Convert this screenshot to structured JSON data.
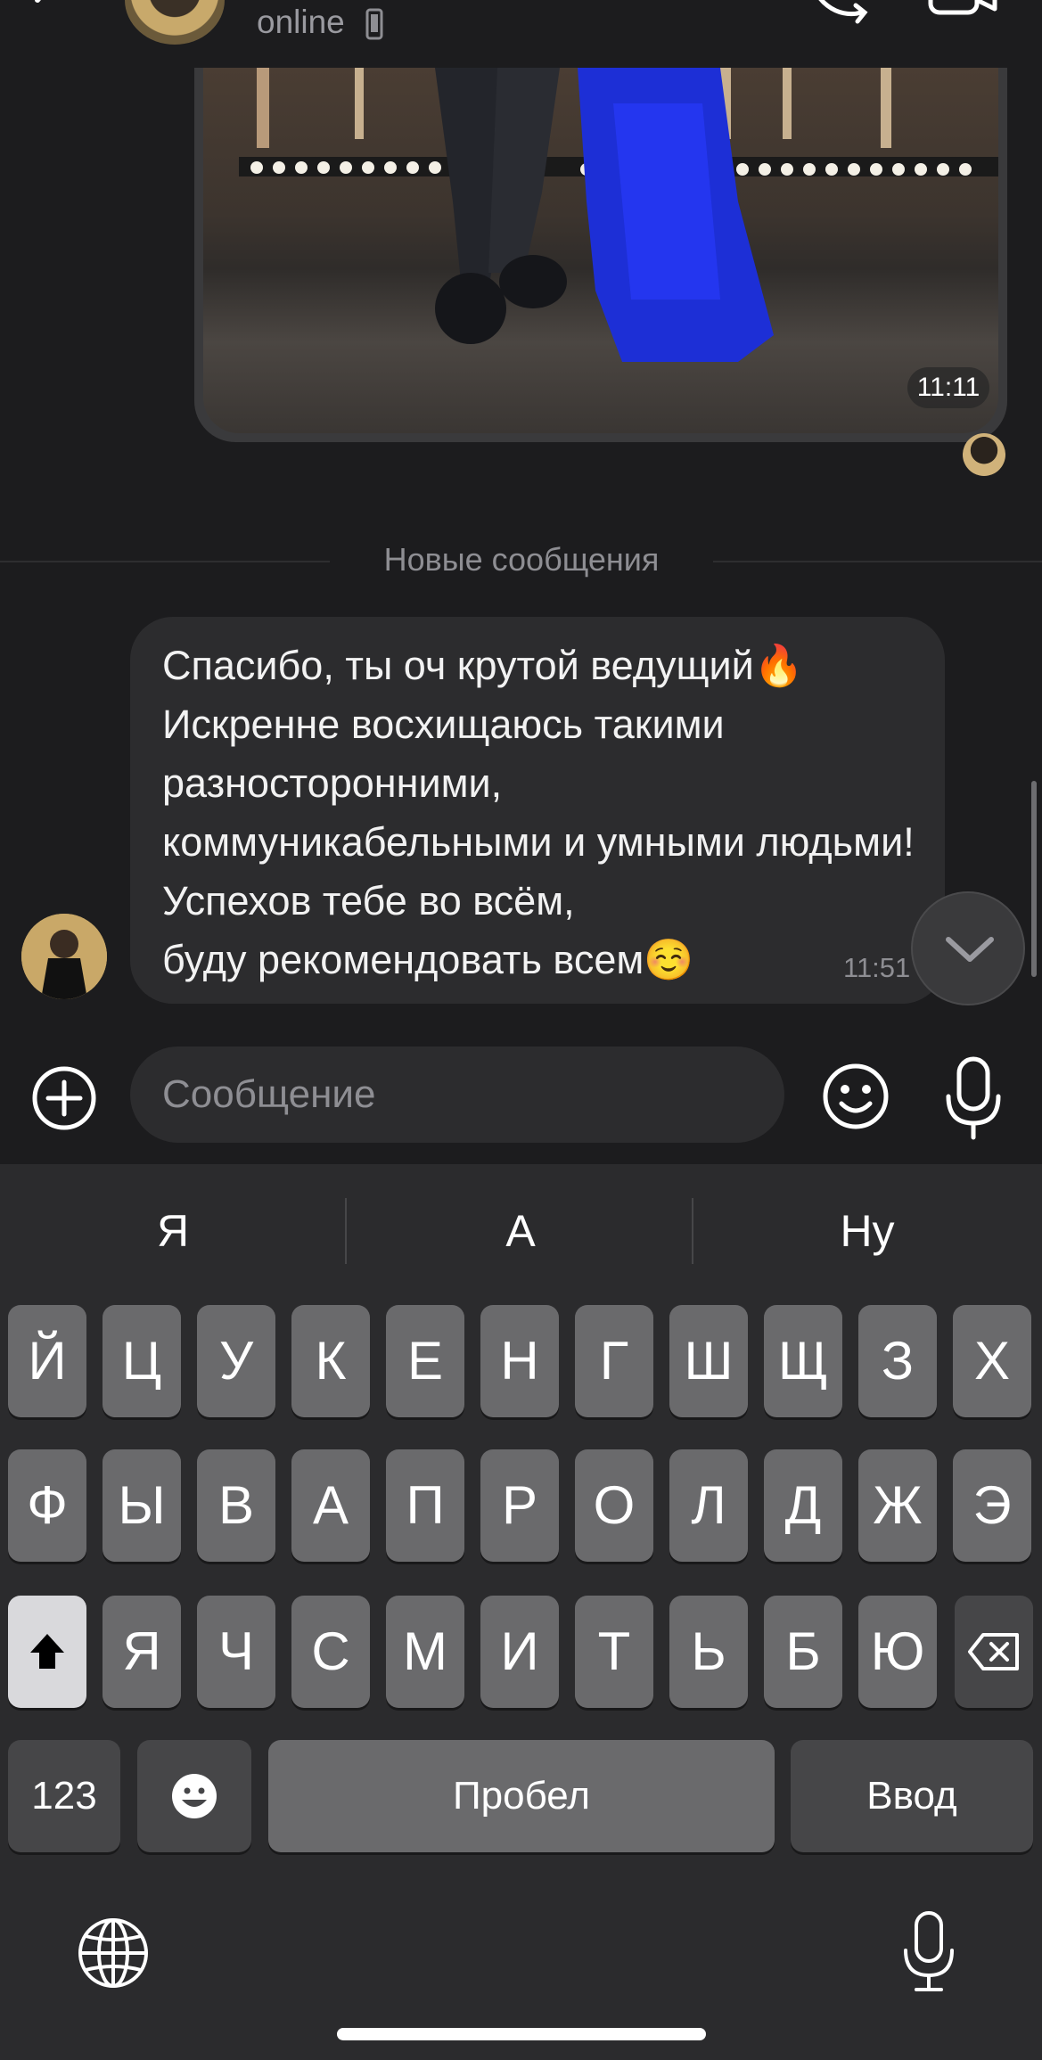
{
  "header": {
    "status": "online"
  },
  "photo_message": {
    "time": "11:11"
  },
  "divider": {
    "label": "Новые сообщения"
  },
  "incoming_message": {
    "text": "Спасибо, ты оч крутой ведущий🔥\nИскренне восхищаюсь такими разносторонними,\nкоммуникабельными и умными людьми! Успехов тебе во всём,\nбуду рекомендовать всем☺️",
    "time": "11:51"
  },
  "composer": {
    "placeholder": "Сообщение"
  },
  "keyboard": {
    "suggestions": [
      "Я",
      "А",
      "Ну"
    ],
    "row1": [
      "Й",
      "Ц",
      "У",
      "К",
      "Е",
      "Н",
      "Г",
      "Ш",
      "Щ",
      "З",
      "Х"
    ],
    "row2": [
      "Ф",
      "Ы",
      "В",
      "А",
      "П",
      "Р",
      "О",
      "Л",
      "Д",
      "Ж",
      "Э"
    ],
    "row3": [
      "Я",
      "Ч",
      "С",
      "М",
      "И",
      "Т",
      "Ь",
      "Б",
      "Ю"
    ],
    "numbers_key": "123",
    "space_key": "Пробел",
    "return_key": "Ввод"
  },
  "icons": {
    "back": "chevron-left-icon",
    "call": "phone-icon",
    "video": "video-camera-icon",
    "device": "phone-device-icon",
    "attach": "plus-circle-icon",
    "emoji": "smile-icon",
    "mic": "microphone-icon",
    "scroll_down": "chevron-down-icon",
    "shift": "shift-arrow-icon",
    "backspace": "backspace-icon",
    "globe": "globe-icon",
    "dictation": "microphone-icon"
  }
}
